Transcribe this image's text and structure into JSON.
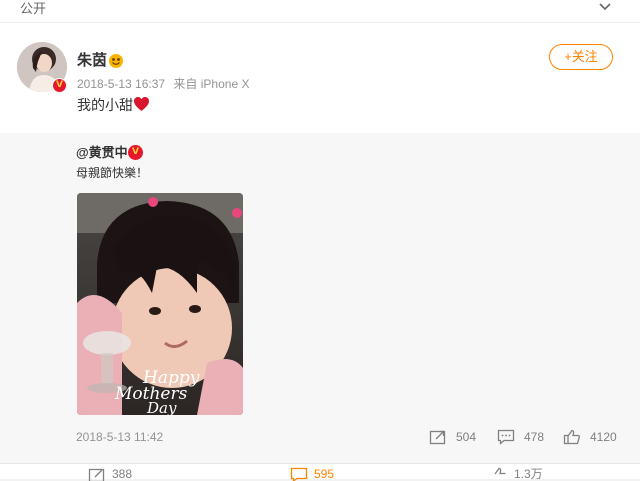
{
  "topbar": {
    "public_label": "公开",
    "chevron_icon": "chevron-down-icon"
  },
  "post": {
    "avatar_icon": "user-avatar",
    "username": "朱茵",
    "user_badge_icon": "emoji-badge-icon",
    "date": "2018-5-13 16:37",
    "source": "来自 iPhone X",
    "follow_label": "+关注",
    "text": "我的小甜",
    "heart_icon": "red-heart-icon"
  },
  "repost": {
    "username": "@黄贯中",
    "verified_icon": "verified-v-icon",
    "text": "母親節快樂！",
    "photo_text": [
      "Happy",
      "Mothers",
      "Day"
    ],
    "timestamp": "2018-5-13 11:42",
    "stats": {
      "reposts": "504",
      "comments": "478",
      "likes": "4120"
    }
  },
  "bottom_bar": {
    "reposts": "388",
    "comments": "595",
    "likes": "1.3万"
  },
  "colors": {
    "accent": "#ff8200",
    "verified": "#e6162d",
    "heart": "#e6162d",
    "muted": "#939393"
  }
}
